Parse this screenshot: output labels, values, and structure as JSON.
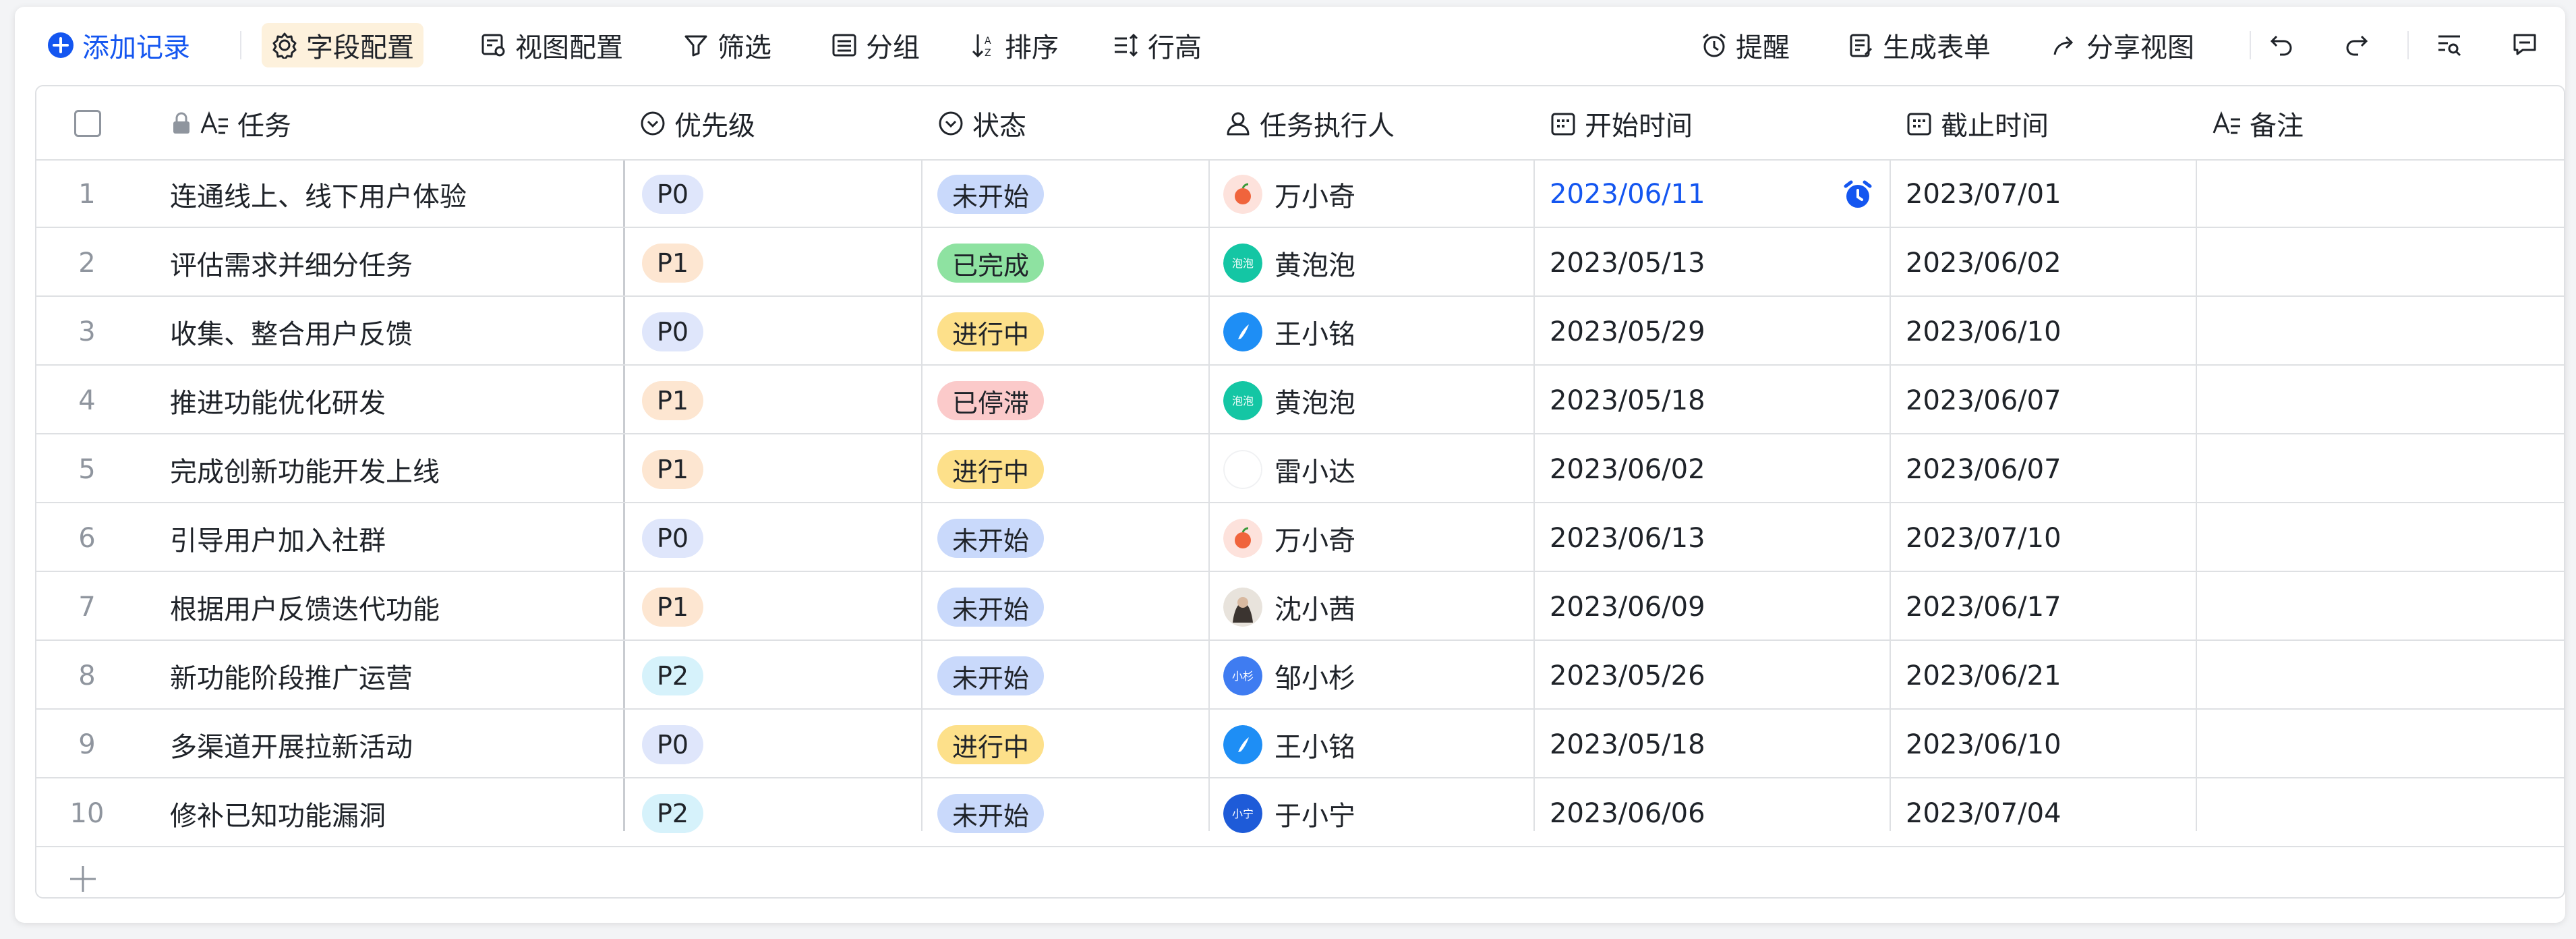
{
  "toolbar": {
    "add_record": "添加记录",
    "field_config": "字段配置",
    "view_config": "视图配置",
    "filter": "筛选",
    "group": "分组",
    "sort": "排序",
    "row_height": "行高",
    "reminder": "提醒",
    "generate_form": "生成表单",
    "share_view": "分享视图"
  },
  "columns": {
    "task": "任务",
    "priority": "优先级",
    "status": "状态",
    "assignee": "任务执行人",
    "start": "开始时间",
    "end": "截止时间",
    "note": "备注"
  },
  "rows": [
    {
      "no": "1",
      "task": "连通线上、线下用户体验",
      "priority": "P0",
      "status": "未开始",
      "assignee": "万小奇",
      "start": "2023/06/11",
      "end": "2023/07/01"
    },
    {
      "no": "2",
      "task": "评估需求并细分任务",
      "priority": "P1",
      "status": "已完成",
      "assignee": "黄泡泡",
      "start": "2023/05/13",
      "end": "2023/06/02"
    },
    {
      "no": "3",
      "task": "收集、整合用户反馈",
      "priority": "P0",
      "status": "进行中",
      "assignee": "王小铭",
      "start": "2023/05/29",
      "end": "2023/06/10"
    },
    {
      "no": "4",
      "task": "推进功能优化研发",
      "priority": "P1",
      "status": "已停滞",
      "assignee": "黄泡泡",
      "start": "2023/05/18",
      "end": "2023/06/07"
    },
    {
      "no": "5",
      "task": "完成创新功能开发上线",
      "priority": "P1",
      "status": "进行中",
      "assignee": "雷小达",
      "start": "2023/06/02",
      "end": "2023/06/07"
    },
    {
      "no": "6",
      "task": "引导用户加入社群",
      "priority": "P0",
      "status": "未开始",
      "assignee": "万小奇",
      "start": "2023/06/13",
      "end": "2023/07/10"
    },
    {
      "no": "7",
      "task": "根据用户反馈迭代功能",
      "priority": "P1",
      "status": "未开始",
      "assignee": "沈小茜",
      "start": "2023/06/09",
      "end": "2023/06/17"
    },
    {
      "no": "8",
      "task": "新功能阶段推广运营",
      "priority": "P2",
      "status": "未开始",
      "assignee": "邹小杉",
      "start": "2023/05/26",
      "end": "2023/06/21"
    },
    {
      "no": "9",
      "task": "多渠道开展拉新活动",
      "priority": "P0",
      "status": "进行中",
      "assignee": "王小铭",
      "start": "2023/05/18",
      "end": "2023/06/10"
    },
    {
      "no": "10",
      "task": "修补已知功能漏洞",
      "priority": "P2",
      "status": "未开始",
      "assignee": "于小宁",
      "start": "2023/06/06",
      "end": "2023/07/04"
    }
  ],
  "avatar_texts": {
    "huang": "泡泡",
    "zou": "小杉",
    "yu": "小宁"
  },
  "colors": {
    "accent": "#1456f0",
    "P0": "#dfe6fb",
    "P1": "#fde6d1",
    "P2": "#d6f2fb",
    "未开始": "#c9d9fb",
    "已完成": "#8ee2a1",
    "进行中": "#fde08a",
    "已停滞": "#fbcaca"
  }
}
